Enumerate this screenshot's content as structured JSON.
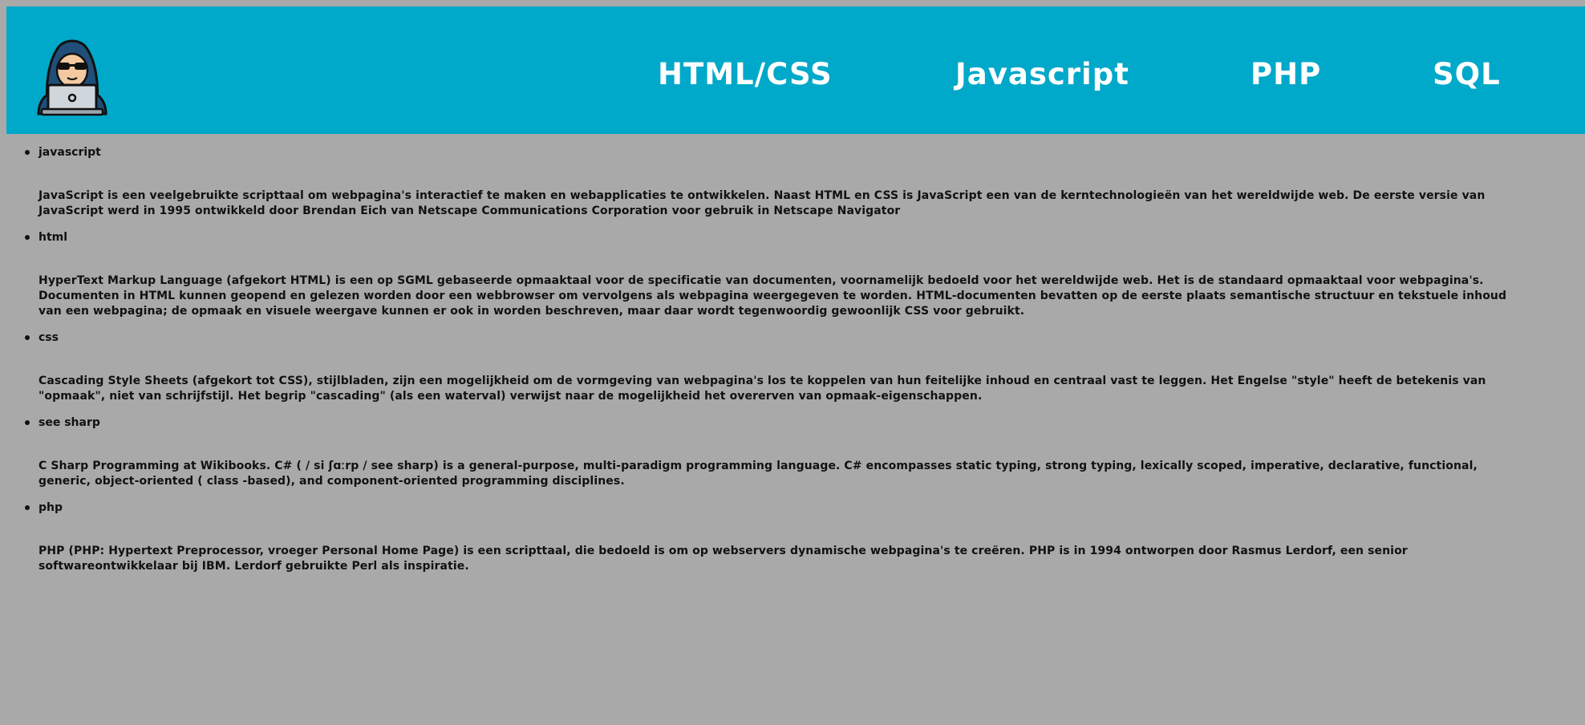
{
  "header": {
    "background_color": "#00a8c9",
    "logo_icon": "hacker-hoodie-laptop-icon",
    "nav": [
      {
        "label": "HTML/CSS"
      },
      {
        "label": "Javascript"
      },
      {
        "label": "PHP"
      },
      {
        "label": "SQL"
      }
    ]
  },
  "page": {
    "background_color": "#a9a9a9"
  },
  "topics": [
    {
      "title": "javascript",
      "text": "JavaScript is een veelgebruikte scripttaal om webpagina's interactief te maken en webapplicaties te ontwikkelen. Naast HTML en CSS is JavaScript een van de kerntechnologieën van het wereldwijde web. De eerste versie van JavaScript werd in 1995 ontwikkeld door Brendan Eich van Netscape Communications Corporation voor gebruik in Netscape Navigator"
    },
    {
      "title": "html",
      "text": "HyperText Markup Language (afgekort HTML) is een op SGML gebaseerde opmaaktaal voor de specificatie van documenten, voornamelijk bedoeld voor het wereldwijde web. Het is de standaard opmaaktaal voor webpagina's. Documenten in HTML kunnen geopend en gelezen worden door een webbrowser om vervolgens als webpagina weergegeven te worden. HTML-documenten bevatten op de eerste plaats semantische structuur en tekstuele inhoud van een webpagina; de opmaak en visuele weergave kunnen er ook in worden beschreven, maar daar wordt tegenwoordig gewoonlijk CSS voor gebruikt."
    },
    {
      "title": "css",
      "text": "Cascading Style Sheets (afgekort tot CSS), stijlbladen, zijn een mogelijkheid om de vormgeving van webpagina's los te koppelen van hun feitelijke inhoud en centraal vast te leggen. Het Engelse \"style\" heeft de betekenis van \"opmaak\", niet van schrijfstijl. Het begrip \"cascading\" (als een waterval) verwijst naar de mogelijkheid het overerven van opmaak-eigenschappen."
    },
    {
      "title": "see sharp",
      "text": "C Sharp Programming at Wikibooks. C# ( / si ʃɑːrp / see sharp) is a general-purpose, multi-paradigm programming language. C# encompasses static typing, strong typing, lexically scoped, imperative, declarative, functional, generic, object-oriented ( class -based), and component-oriented programming disciplines."
    },
    {
      "title": "php",
      "text": "PHP (PHP: Hypertext Preprocessor, vroeger Personal Home Page) is een scripttaal, die bedoeld is om op webservers dynamische webpagina's te creëren. PHP is in 1994 ontworpen door Rasmus Lerdorf, een senior softwareontwikkelaar bij IBM. Lerdorf gebruikte Perl als inspiratie."
    }
  ]
}
